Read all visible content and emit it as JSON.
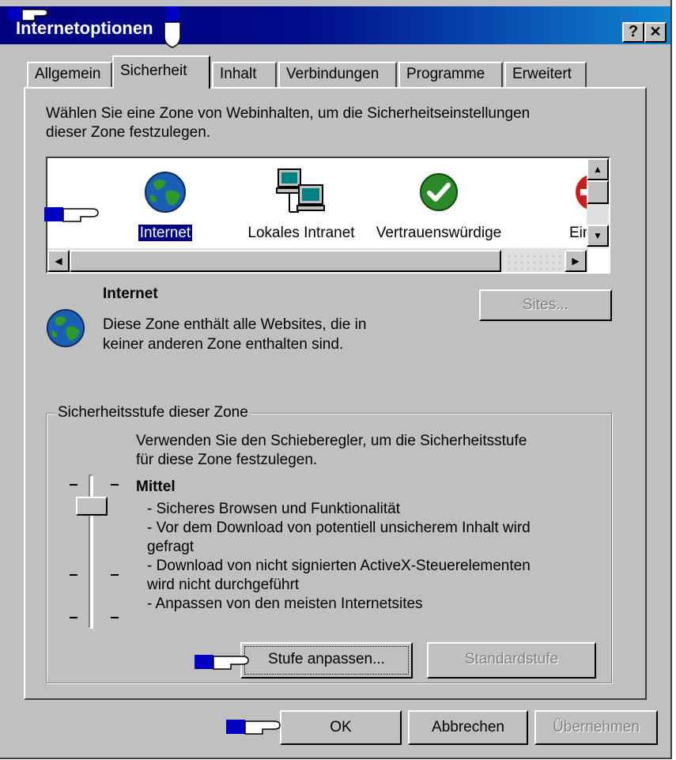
{
  "window": {
    "title": "Internetoptionen",
    "help_glyph": "?",
    "close_glyph": "✕"
  },
  "tabs": [
    {
      "label": "Allgemein"
    },
    {
      "label": "Sicherheit"
    },
    {
      "label": "Inhalt"
    },
    {
      "label": "Verbindungen"
    },
    {
      "label": "Programme"
    },
    {
      "label": "Erweitert"
    }
  ],
  "intro": {
    "line1": "Wählen Sie eine Zone von Webinhalten, um die Sicherheitseinstellungen",
    "line2": "dieser Zone festzulegen."
  },
  "zones": [
    {
      "label": "Internet",
      "icon": "globe-icon"
    },
    {
      "label": "Lokales Intranet",
      "icon": "network-computers-icon"
    },
    {
      "label": "Vertrauenswürdige",
      "icon": "green-check-icon"
    },
    {
      "label": "Einges",
      "icon": "restricted-icon"
    }
  ],
  "zone_info": {
    "title": "Internet",
    "desc_line1": "Diese Zone enthält alle Websites, die in",
    "desc_line2": "keiner anderen Zone enthalten sind.",
    "sites_button": "Sites..."
  },
  "security_level": {
    "group_title": "Sicherheitsstufe dieser Zone",
    "hint_line1": "Verwenden Sie den Schieberegler, um die Sicherheitsstufe",
    "hint_line2": "für diese Zone festzulegen.",
    "level_name": "Mittel",
    "items": [
      "- Sicheres Browsen und Funktionalität",
      "- Vor dem Download von potentiell  unsicherem Inhalt wird",
      "gefragt",
      "- Download von nicht signierten ActiveX-Steuerelementen",
      "wird nicht durchgeführt",
      "- Anpassen von den meisten Internetsites"
    ],
    "custom_button": "Stufe anpassen...",
    "default_button": "Standardstufe"
  },
  "footer": {
    "ok": "OK",
    "cancel": "Abbrechen",
    "apply": "Übernehmen"
  },
  "colors": {
    "titlebar": "#000080",
    "face": "#c0c0c0",
    "selection": "#000080"
  }
}
